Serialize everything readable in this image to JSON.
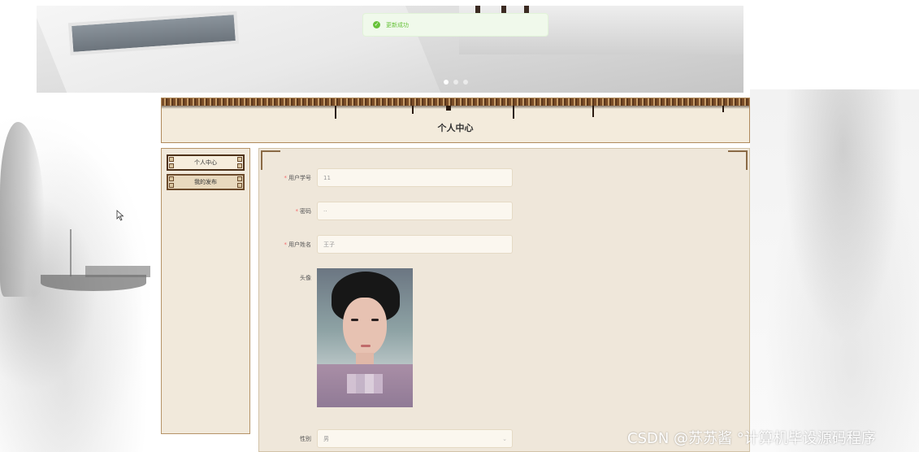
{
  "toast": {
    "message": "更新成功",
    "icon": "check-circle-icon"
  },
  "carousel": {
    "dots": 3,
    "active_index": 0
  },
  "header": {
    "title": "个人中心"
  },
  "sidebar": {
    "items": [
      {
        "label": "个人中心",
        "active": true
      },
      {
        "label": "我的发布",
        "active": false
      }
    ]
  },
  "form": {
    "student_id": {
      "label": "用户学号",
      "required": true,
      "value": "11"
    },
    "password": {
      "label": "密码",
      "required": true,
      "value": "··"
    },
    "name": {
      "label": "用户姓名",
      "required": true,
      "value": "王子"
    },
    "avatar": {
      "label": "头像"
    },
    "gender": {
      "label": "性别",
      "value": "男"
    }
  },
  "watermark": "CSDN @苏苏酱    °计算机毕设源码程序",
  "colors": {
    "success": "#67c23a",
    "required": "#f56c6c",
    "panel": "#efe7da",
    "border_brown": "#6b4a2b"
  }
}
